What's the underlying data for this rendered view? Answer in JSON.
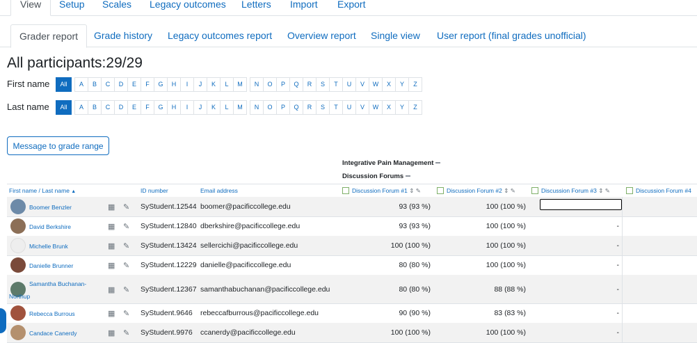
{
  "top_tabs": [
    "View",
    "Setup",
    "Scales",
    "Legacy outcomes",
    "Letters",
    "Import",
    "Export"
  ],
  "sub_tabs": [
    "Grader report",
    "Grade history",
    "Legacy outcomes report",
    "Overview report",
    "Single view",
    "User report (final grades unofficial)"
  ],
  "page_title": "All participants:29/29",
  "filters": {
    "first_name_label": "First name",
    "last_name_label": "Last name",
    "all_label": "All",
    "letters": [
      "A",
      "B",
      "C",
      "D",
      "E",
      "F",
      "G",
      "H",
      "I",
      "J",
      "K",
      "L",
      "M",
      "N",
      "O",
      "P",
      "Q",
      "R",
      "S",
      "T",
      "U",
      "V",
      "W",
      "X",
      "Y",
      "Z"
    ]
  },
  "message_button": "Message to grade range",
  "category": {
    "course": "Integrative Pain Management",
    "forums": "Discussion Forums"
  },
  "columns": {
    "name": "First name / Last name",
    "id": "ID number",
    "email": "Email address",
    "items": [
      "Discussion Forum #1",
      "Discussion Forum #2",
      "Discussion Forum #3",
      "Discussion Forum #4"
    ]
  },
  "rows": [
    {
      "name": "Boomer Benzler",
      "id": "SyStudent.12544",
      "email": "boomer@pacificcollege.edu",
      "f1": "93 (93 %)",
      "f2": "100 (100 %)",
      "f3": ""
    },
    {
      "name": "David Berkshire",
      "id": "SyStudent.12840",
      "email": "dberkshire@pacificcollege.edu",
      "f1": "93 (93 %)",
      "f2": "100 (100 %)",
      "f3": "-"
    },
    {
      "name": "Michelle Brunk",
      "id": "SyStudent.13424",
      "email": "sellercichi@pacificcollege.edu",
      "f1": "100 (100 %)",
      "f2": "100 (100 %)",
      "f3": "-"
    },
    {
      "name": "Danielle Brunner",
      "id": "SyStudent.12229",
      "email": "danielle@pacificcollege.edu",
      "f1": "80 (80 %)",
      "f2": "100 (100 %)",
      "f3": "-"
    },
    {
      "name_line1": "Samantha Buchanan-",
      "name_line2": "Northup",
      "id": "SyStudent.12367",
      "email": "samanthabuchanan@pacificcollege.edu",
      "f1": "80 (80 %)",
      "f2": "88 (88 %)",
      "f3": "-"
    },
    {
      "name": "Rebecca Burrous",
      "id": "SyStudent.9646",
      "email": "rebeccafburrous@pacificcollege.edu",
      "f1": "90 (90 %)",
      "f2": "83 (83 %)",
      "f3": "-"
    },
    {
      "name": "Candace Canerdy",
      "id": "SyStudent.9976",
      "email": "ccanerdy@pacificcollege.edu",
      "f1": "100 (100 %)",
      "f2": "100 (100 %)",
      "f3": "-"
    }
  ]
}
